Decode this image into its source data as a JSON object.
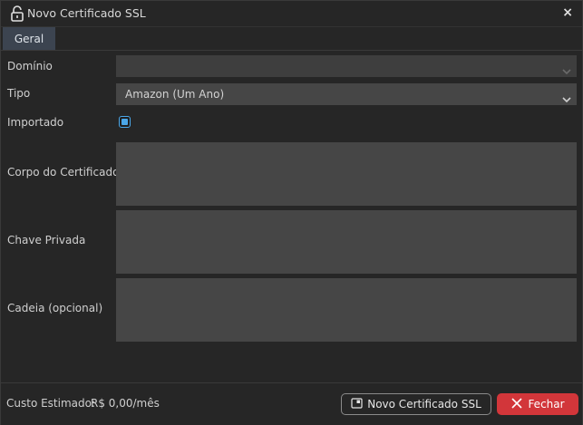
{
  "window": {
    "title": "Novo Certificado SSL",
    "close_glyph": "×"
  },
  "tabs": [
    {
      "label": "Geral",
      "active": true
    }
  ],
  "form": {
    "domain_label": "Domínio",
    "domain_value": "",
    "type_label": "Tipo",
    "type_value": "Amazon (Um Ano)",
    "imported_label": "Importado",
    "imported_checked": true,
    "cert_body_label": "Corpo do Certificado",
    "private_key_label": "Chave Privada",
    "chain_label": "Cadeia (opcional)"
  },
  "footer": {
    "cost_label": "Custo Estimado:",
    "cost_value": "R$ 0,00/mês",
    "new_button_label": "Novo Certificado SSL",
    "close_button_label": "Fechar"
  },
  "colors": {
    "accent": "#4aa6e8",
    "danger": "#d2363a",
    "tab_active": "#3c4450"
  },
  "icons": {
    "title": "lock-open-icon",
    "new_button": "certificate-icon",
    "close_button": "x-icon",
    "dropdown": "chevron-down-icon"
  }
}
